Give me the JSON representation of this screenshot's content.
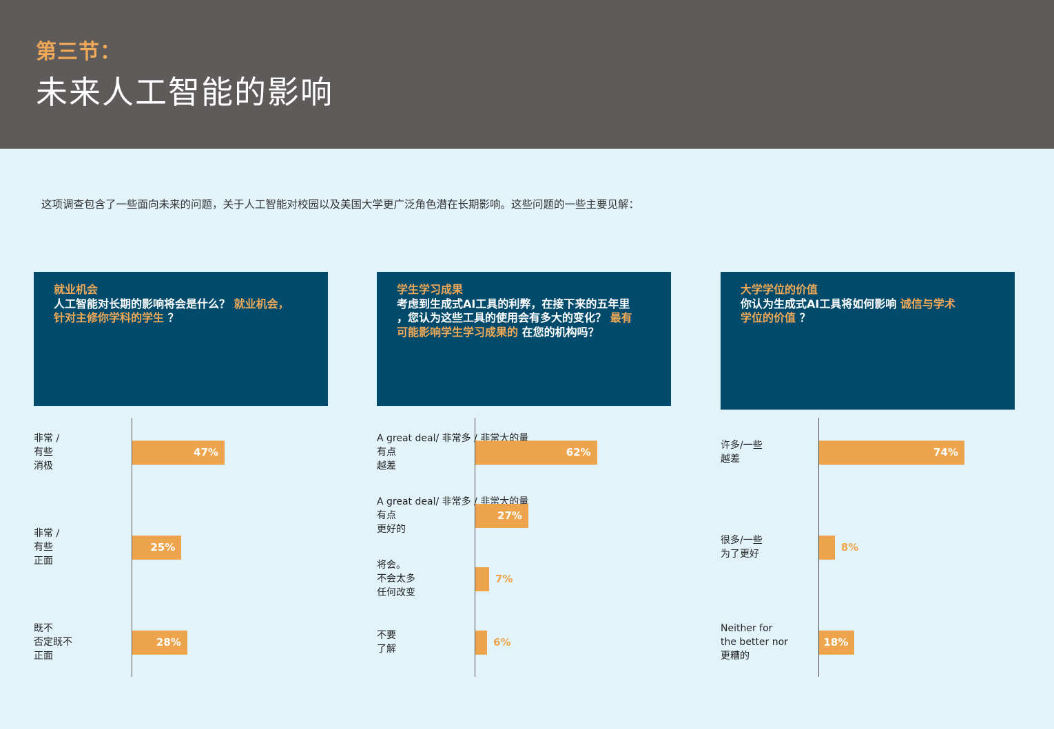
{
  "header": {
    "section_label": "第三节：",
    "section_title": "未来人工智能的影响"
  },
  "intro": "这项调查包含了一些面向未来的问题，关于人工智能对校园以及美国大学更广泛角色潜在长期影响。这些问题的一些主要见解：",
  "colors": {
    "header_bg": "#5f5b5a",
    "panel_bg": "#004a6b",
    "accent": "#eda44c",
    "page_bg": "#e2f3fa"
  },
  "panels": [
    {
      "title": "就业机会",
      "q1": "人工智能对长期的影响将会是什么？",
      "q2": "就业机会，",
      "q3": "针对主修你学科的学生",
      "q4": "？"
    },
    {
      "title": "学生学习成果",
      "q1": "考虑到生成式AI工具的利弊，在接下来的五年里",
      "q2": "，您认为这些工具的使用会有多大的变化？",
      "q3": "最有",
      "q4": "可能影响学生学习成果的",
      "q5": "在您的机构吗？"
    },
    {
      "title": "大学学位的价值",
      "q1": "你认为生成式AI工具将如何影响",
      "q2": "诚信与学术",
      "q3": "学位的价值",
      "q4": "？"
    }
  ],
  "chart_data": [
    {
      "type": "bar",
      "orientation": "horizontal",
      "categories": [
        [
          "非常 /",
          "有些",
          "消极"
        ],
        [
          "非常 /",
          "有些",
          "正面"
        ],
        [
          "既不",
          "否定既不",
          "正面"
        ]
      ],
      "values": [
        47,
        25,
        28
      ],
      "value_labels": [
        "47%",
        "25%",
        "28%"
      ],
      "unit": "%"
    },
    {
      "type": "bar",
      "orientation": "horizontal",
      "categories": [
        [
          "A great deal/ 非常多 / 非常大的量",
          "有点",
          "越差"
        ],
        [
          "A great deal/ 非常多 / 非常大的量",
          "有点",
          "更好的"
        ],
        [
          "将会。",
          "不会太多",
          "任何改变"
        ],
        [
          "不要",
          "了解"
        ]
      ],
      "values": [
        62,
        27,
        7,
        6
      ],
      "value_labels": [
        "62%",
        "27%",
        "7%",
        "6%"
      ],
      "unit": "%"
    },
    {
      "type": "bar",
      "orientation": "horizontal",
      "categories": [
        [
          "许多/一些",
          "越差"
        ],
        [
          "很多/一些",
          "为了更好"
        ],
        [
          "Neither for",
          "the better nor",
          "更糟的"
        ]
      ],
      "values": [
        74,
        8,
        18
      ],
      "value_labels": [
        "74%",
        "8%",
        "18%"
      ],
      "unit": "%"
    }
  ]
}
